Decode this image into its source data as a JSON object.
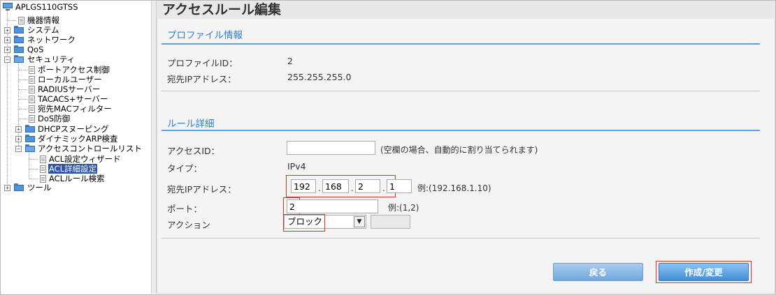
{
  "tree": {
    "root": "APLGS110GTSS",
    "items": [
      {
        "label": "機器情報"
      },
      {
        "label": "システム"
      },
      {
        "label": "ネットワーク"
      },
      {
        "label": "QoS"
      },
      {
        "label": "セキュリティ"
      },
      {
        "label": "ポートアクセス制御"
      },
      {
        "label": "ローカルユーザー"
      },
      {
        "label": "RADIUSサーバー"
      },
      {
        "label": "TACACS+サーバー"
      },
      {
        "label": "宛先MACフィルター"
      },
      {
        "label": "DoS防御"
      },
      {
        "label": "DHCPスヌーピング"
      },
      {
        "label": "ダイナミックARP検査"
      },
      {
        "label": "アクセスコントロールリスト"
      },
      {
        "label": "ACL設定ウィザード"
      },
      {
        "label": "ACL詳細設定"
      },
      {
        "label": "ACLルール検索"
      },
      {
        "label": "ツール"
      }
    ],
    "expander_plus": "+",
    "expander_minus": "−"
  },
  "page": {
    "title": "アクセスルール編集"
  },
  "profile": {
    "section_title": "プロファイル情報",
    "id_label": "プロファイルID：",
    "id_value": "2",
    "ip_label": "宛先IPアドレス：",
    "ip_value": "255.255.255.0"
  },
  "rule": {
    "section_title": "ルール詳細",
    "access_id_label": "アクセスID：",
    "access_id_value": "",
    "access_id_hint": "(空欄の場合、自動的に割り当てられます)",
    "type_label": "タイプ：",
    "type_value": "IPv4",
    "ip_label": "宛先IPアドレス：",
    "ip_octets": [
      "192",
      "168",
      "2",
      "1"
    ],
    "ip_sep": ".",
    "ip_hint": "例:(192.168.1.10)",
    "port_label": "ポート：",
    "port_value": "2",
    "port_hint": "例:(1,2)",
    "action_label": "アクション",
    "action_value": "ブロック",
    "action_arrow": "▼"
  },
  "buttons": {
    "back": "戻る",
    "submit": "作成/変更"
  },
  "colors": {
    "accent": "#2f7fc9",
    "highlight_box": "#d9342b",
    "selected": "#2b56a8"
  }
}
